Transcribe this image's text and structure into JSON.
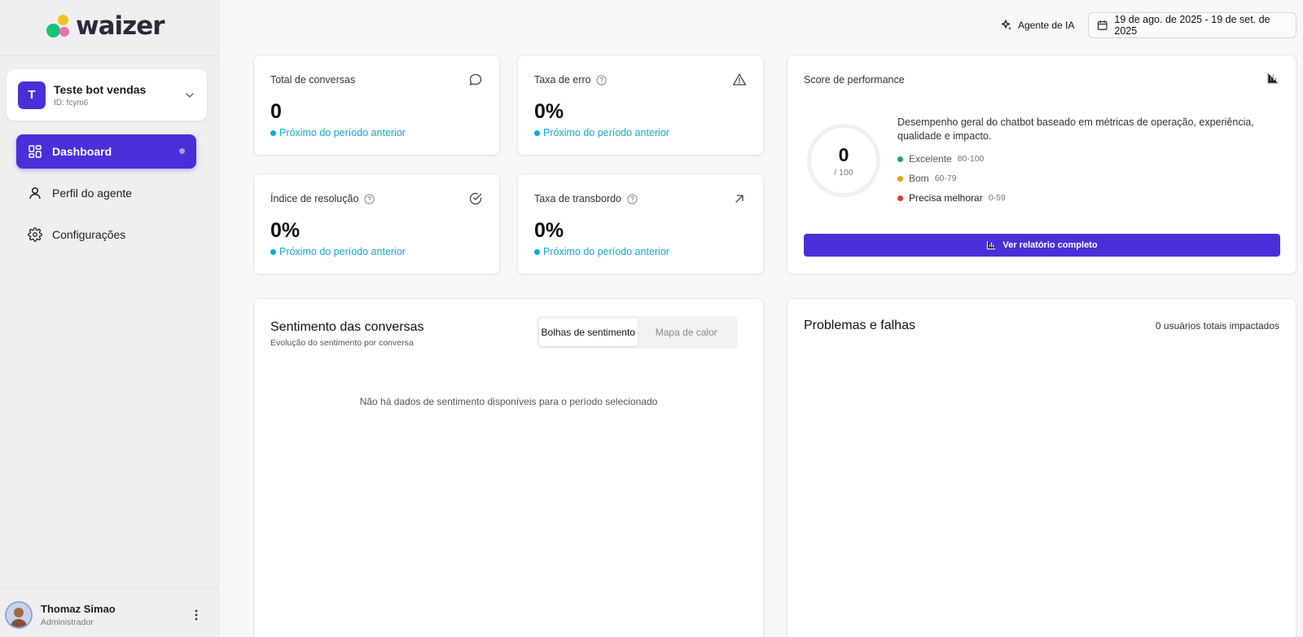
{
  "brand": {
    "name": "waizer",
    "colors": [
      "#19c17a",
      "#f4c21b",
      "#f06ea8"
    ]
  },
  "workspace": {
    "initial": "T",
    "name": "Teste bot vendas",
    "id": "ID: fcym6"
  },
  "nav": [
    {
      "label": "Dashboard",
      "icon": "grid-icon",
      "active": true
    },
    {
      "label": "Perfil do agente",
      "icon": "user-icon",
      "active": false
    },
    {
      "label": "Configurações",
      "icon": "gear-icon",
      "active": false
    }
  ],
  "user": {
    "name": "Thomaz Simao",
    "role": "Administrador"
  },
  "header": {
    "agent_label": "Agente de IA",
    "date_range": "19 de ago. de 2025 - 19 de set. de 2025"
  },
  "metrics": [
    {
      "title": "Total de conversas",
      "value": "0",
      "note": "Próximo do período anterior",
      "icon": "chat-icon",
      "help": false
    },
    {
      "title": "Taxa de erro",
      "value": "0%",
      "note": "Próximo do período anterior",
      "icon": "warning-icon",
      "help": true
    },
    {
      "title": "Índice de resolução",
      "value": "0%",
      "note": "Próximo do período anterior",
      "icon": "check-circle-icon",
      "help": true
    },
    {
      "title": "Taxa de transbordo",
      "value": "0%",
      "note": "Próximo do período anterior",
      "icon": "arrow-up-right-icon",
      "help": true
    }
  ],
  "performance": {
    "title": "Score de performance",
    "score": "0",
    "max": "/ 100",
    "description": "Desempenho geral do chatbot baseado em métricas de operação, experiência, qualidade e impacto.",
    "legend": [
      {
        "label": "Excelente",
        "range": "80-100",
        "color": "#1aa869"
      },
      {
        "label": "Bom",
        "range": "60-79",
        "color": "#f39c12"
      },
      {
        "label": "Precisa melhorar",
        "range": "0-59",
        "color": "#e53935"
      }
    ],
    "button_label": "Ver relatório completo"
  },
  "sentiment": {
    "title": "Sentimento das conversas",
    "subtitle": "Evolução do sentimento por conversa",
    "tabs": [
      "Bolhas de sentimento",
      "Mapa de calor"
    ],
    "empty_message": "Não há dados de sentimento disponíveis para o período selecionado"
  },
  "problems": {
    "title": "Problemas e falhas",
    "impacted": "0 usuários totais impactados"
  },
  "accent": "#4a2fd8",
  "info_color": "#11a8d8"
}
